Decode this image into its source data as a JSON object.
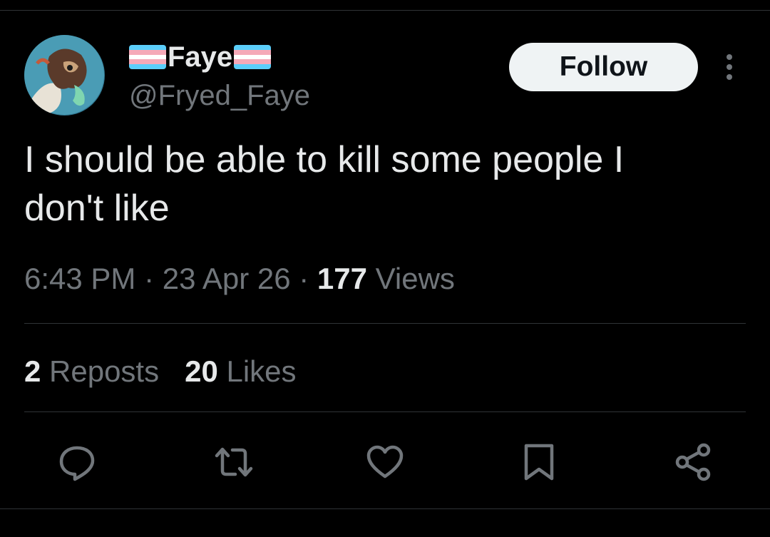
{
  "author": {
    "display_name": "Faye",
    "handle": "@Fryed_Faye",
    "name_decoration": "transgender-flag-emoji"
  },
  "follow_button": {
    "label": "Follow"
  },
  "more_button": {
    "icon": "more-vertical-icon"
  },
  "tweet": {
    "text_line1": "I should be able to kill some people I",
    "text_line2": "don't like"
  },
  "meta": {
    "time": "6:43 PM",
    "separator1": " · ",
    "date": "23 Apr 26",
    "separator2": " · ",
    "views_count": "177",
    "views_label": " Views"
  },
  "stats": {
    "reposts_count": "2",
    "reposts_label": " Reposts",
    "likes_count": "20",
    "likes_label": " Likes"
  },
  "actions": [
    "reply-icon",
    "repost-icon",
    "like-icon",
    "bookmark-icon",
    "share-icon"
  ],
  "colors": {
    "background": "#000000",
    "primary_text": "#e7e9ea",
    "secondary_text": "#71767b",
    "divider": "#2f3336",
    "follow_bg": "#eff3f4",
    "flag_blue": "#5bcefa",
    "flag_pink": "#f5a9b8",
    "flag_white": "#ffffff"
  }
}
